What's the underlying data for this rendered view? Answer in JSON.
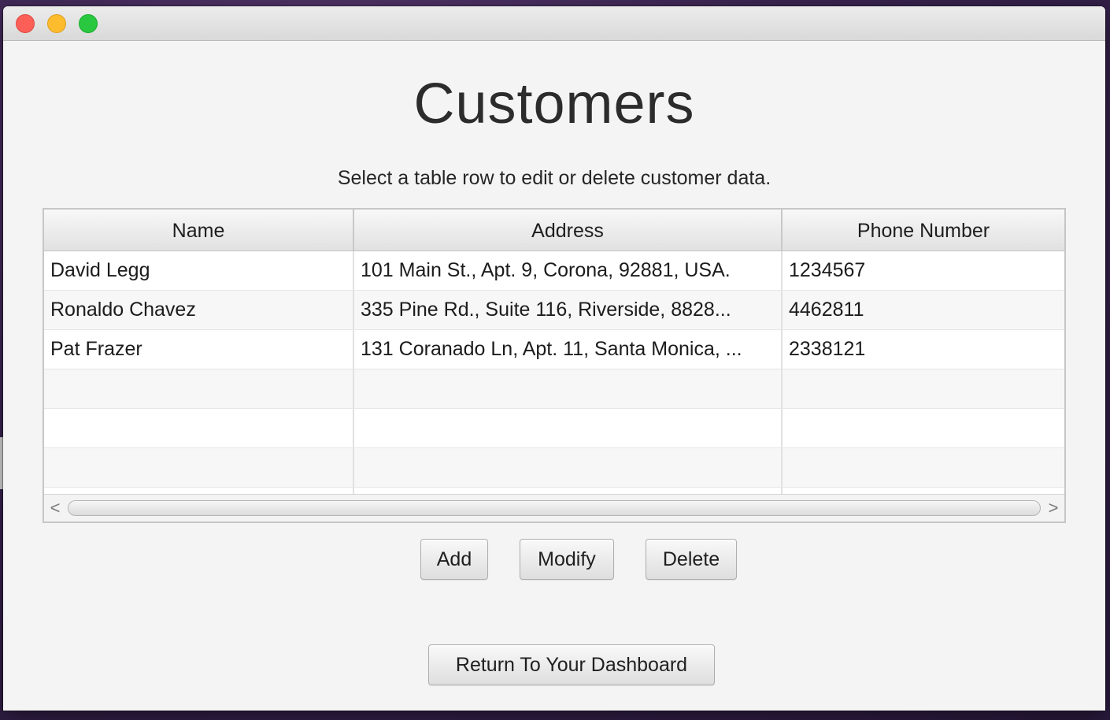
{
  "header": {
    "title": "Customers",
    "subtitle": "Select a table row to edit or delete customer data."
  },
  "table": {
    "columns": [
      "Name",
      "Address",
      "Phone Number"
    ],
    "rows": [
      [
        "David Legg",
        "101 Main St., Apt. 9, Corona, 92881, USA.",
        "1234567"
      ],
      [
        "Ronaldo Chavez",
        "335 Pine Rd., Suite 116, Riverside, 8828...",
        "4462811"
      ],
      [
        "Pat Frazer",
        "131 Coranado Ln, Apt. 11, Santa Monica, ...",
        "2338121"
      ]
    ],
    "scroll_left_glyph": "<",
    "scroll_right_glyph": ">"
  },
  "actions": {
    "add_label": "Add",
    "modify_label": "Modify",
    "delete_label": "Delete",
    "return_label": "Return To Your Dashboard"
  },
  "colors": {
    "window_bg": "#f4f4f4",
    "close_light": "#fc5f57",
    "minimize_light": "#fdbc2e",
    "maximize_light": "#2ac840"
  },
  "icons": {
    "close": "close-window-icon",
    "minimize": "minimize-window-icon",
    "maximize": "maximize-window-icon",
    "scroll_left": "chevron-left-icon",
    "scroll_right": "chevron-right-icon"
  }
}
